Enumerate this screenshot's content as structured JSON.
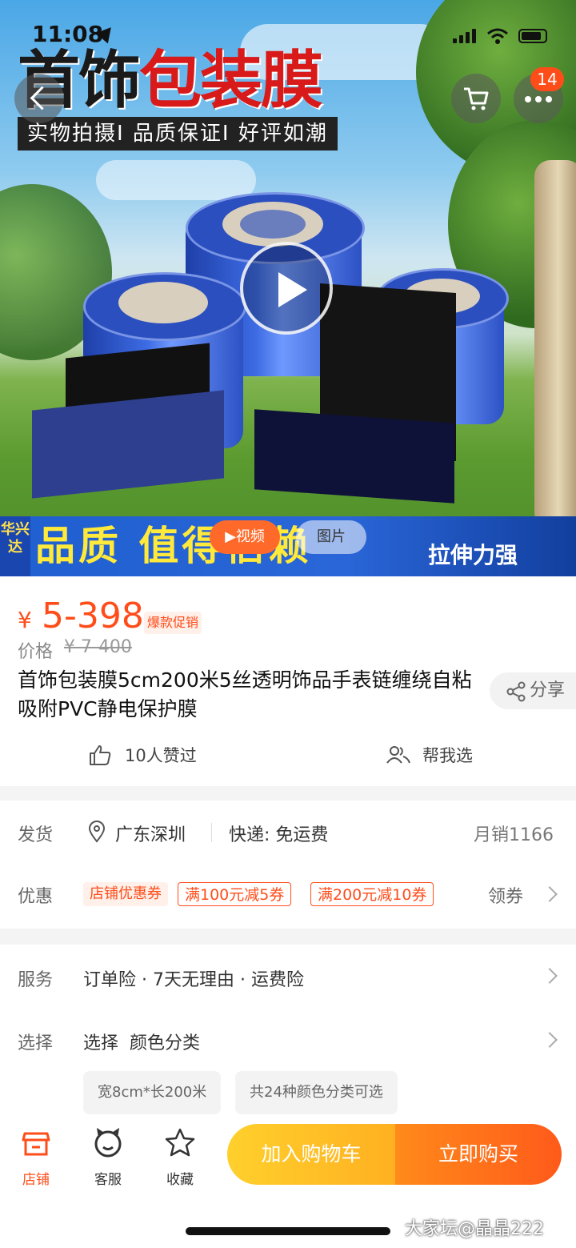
{
  "status_bar": {
    "time": "11:08"
  },
  "hero": {
    "promo_title_a": "首饰",
    "promo_title_b": "包装膜",
    "promo_subtitle": "实物拍摄I 品质保证I 好评如潮",
    "banner_brand": "华兴达",
    "banner_main": "品质 值得信赖",
    "banner_right": "拉伸力强",
    "video_label": "▶视频",
    "image_label": "图片",
    "badge_count": "14"
  },
  "price": {
    "currency": "¥",
    "value": "5-398",
    "tag": "爆款促销",
    "original_label": "价格",
    "original_value": "¥ 7-400"
  },
  "product": {
    "title": "首饰包装膜5cm200米5丝透明饰品手表链缠绕自粘吸附PVC静电保护膜",
    "share_label": "分享",
    "likes_label": "10人赞过",
    "help_label": "帮我选"
  },
  "shipping": {
    "label": "发货",
    "location": "广东深圳",
    "delivery": "快递: 免运费",
    "monthly_sales": "月销1166"
  },
  "promotion": {
    "label": "优惠",
    "coupons": [
      "店铺优惠券",
      "满100元减5券",
      "满200元减10券"
    ],
    "action": "领券"
  },
  "service": {
    "label": "服务",
    "value": "订单险 · 7天无理由 · 运费险"
  },
  "select": {
    "label": "选择",
    "value": "选择  颜色分类",
    "chips": [
      "宽8cm*长200米",
      "共24种颜色分类可选"
    ]
  },
  "bottom_nav": {
    "shop": "店铺",
    "service": "客服",
    "favorite": "收藏",
    "add_to_cart": "加入购物车",
    "buy_now": "立即购买"
  },
  "watermark": "大家坛@晶晶222",
  "colors": {
    "accent": "#ff4d1a",
    "cart": "#ffb021",
    "buy": "#ff5a1a"
  }
}
